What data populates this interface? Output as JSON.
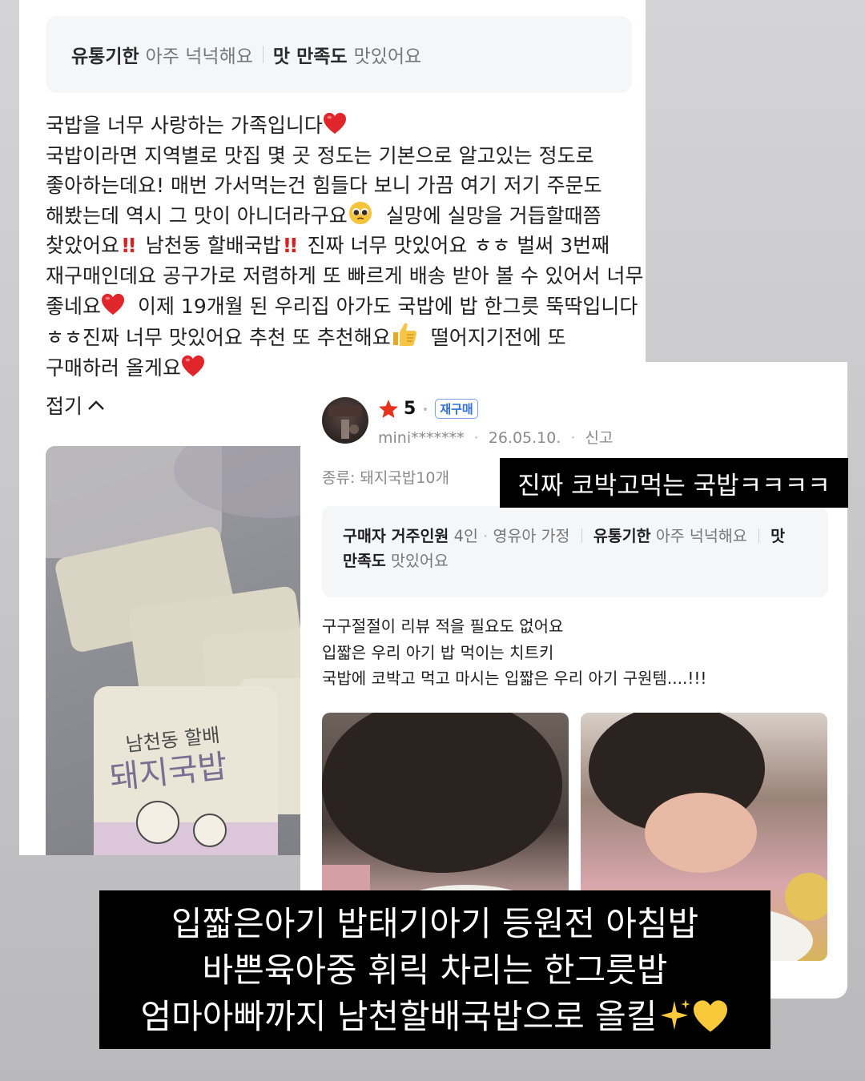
{
  "review_top": {
    "attributes": [
      {
        "key": "유통기한",
        "value": "아주 넉넉해요"
      },
      {
        "key": "맛 만족도",
        "value": "맛있어요"
      }
    ],
    "body_lines": [
      "국밥을 너무 사랑하는 가족입니다",
      "국밥이라면 지역별로 맛집 몇 곳 정도는 기본으로 알고있는 정도로",
      "좋아하는데요! 매번 가서먹는건 힘들다 보니 가끔 여기 저기 주문도",
      "해봤는데 역시 그 맛이 아니더라구요",
      "실망에 실망을 거듭할때쯤",
      "찾았어요",
      "남천동 할배국밥",
      "진짜 너무 맛있어요 ㅎㅎ 벌써 3번째",
      "재구매인데요 공구가로 저렴하게 또 빠르게 배송 받아 볼 수 있어서 너무",
      "좋네요",
      "이제 19개월 된 우리집 아가도 국밥에 밥 한그릇 뚝딱입니다",
      "ㅎㅎ진짜 너무 맛있어요 추천 또 추천해요",
      "떨어지기전에 또",
      "구매하러 올게요"
    ],
    "fold_label": "접기",
    "photo_pack_texts": [
      "남천동 할배",
      "돼지국밥"
    ]
  },
  "review_front": {
    "rating": "5",
    "rebuy_badge": "재구매",
    "user": "mini*******",
    "date": "26.05.10.",
    "report": "신고",
    "kind": "종류: 돼지국밥10개",
    "attributes_line1": [
      {
        "key": "구매자 거주인원",
        "value": "4인"
      },
      {
        "key": "",
        "value": "영유아 가정"
      },
      {
        "key": "유통기한",
        "value": "아주 넉넉해요"
      },
      {
        "key": "맛",
        "value": ""
      }
    ],
    "attributes_line2": {
      "key": "만족도",
      "value": "맛있어요"
    },
    "body_lines": [
      "구구절절이 리뷰 적을 필요도 없어요",
      "입짧은 우리 아기 밥 먹이는 치트키",
      "국밥에 코박고 먹고 마시는 입짧은 우리 아기 구원템....!!!"
    ]
  },
  "captions": {
    "top": "진짜 코박고먹는 국밥ㅋㅋㅋㅋ",
    "bottom_lines": [
      "입짧은아기 밥태기아기 등원전 아침밥",
      "바쁜육아중 휘릭 차리는 한그릇밥",
      "엄마아빠까지 남천할배국밥으로 올킬"
    ]
  },
  "colors": {
    "heart": "#e0262b",
    "star": "#e8321e",
    "badge_blue": "#2f6fd6"
  },
  "icons": [
    "heart-icon",
    "double-exclamation-icon",
    "pleading-face-icon",
    "thumbs-up-icon",
    "star-icon",
    "chevron-up-icon",
    "sparkles-icon",
    "yellow-heart-icon",
    "lighthouse-avatar"
  ]
}
